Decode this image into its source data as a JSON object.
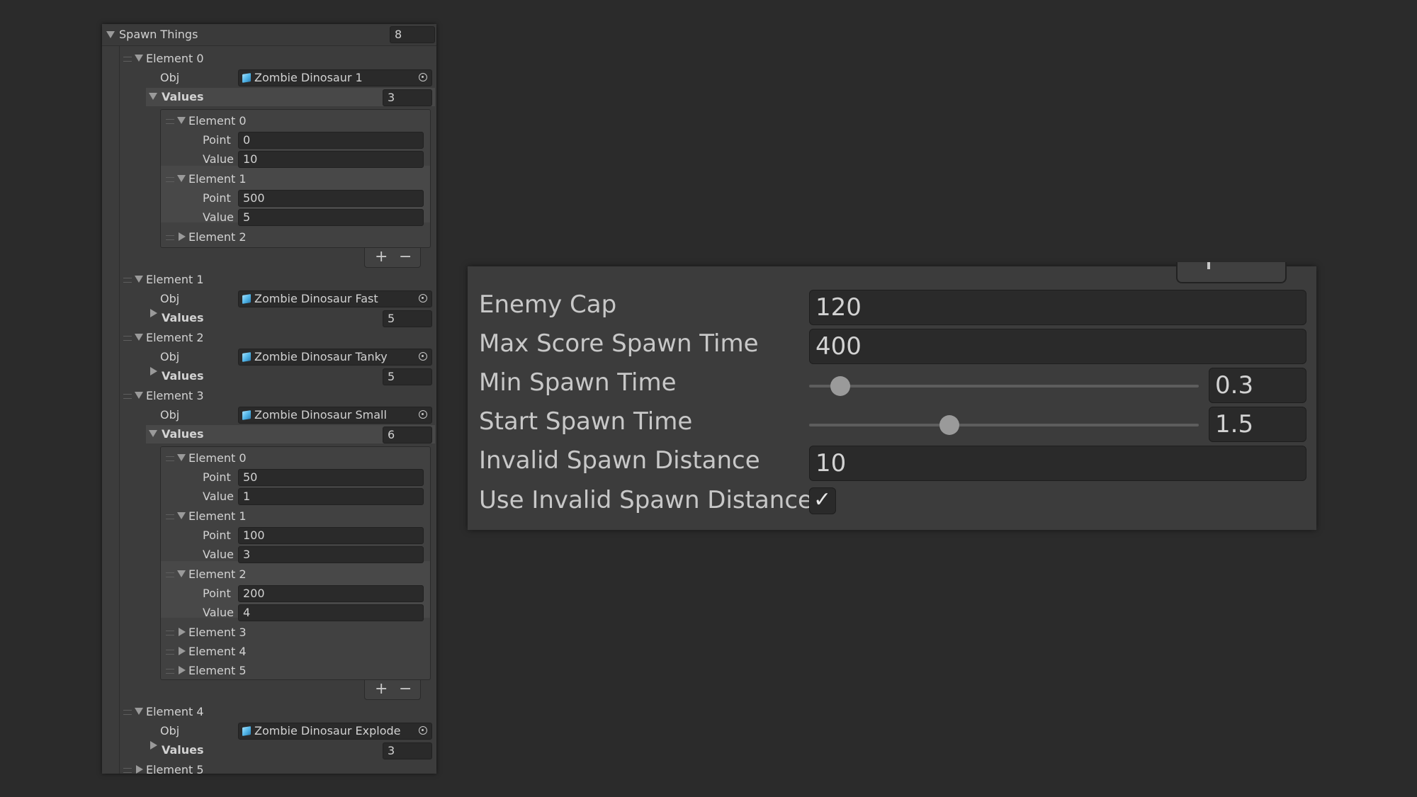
{
  "spawn_things": {
    "label": "Spawn Things",
    "size": "8",
    "elements": [
      {
        "label": "Element 0",
        "obj_label": "Obj",
        "obj": "Zombie Dinosaur 1",
        "values_label": "Values",
        "values_size": "3",
        "values": [
          {
            "label": "Element 0",
            "point_label": "Point",
            "point": "0",
            "value_label": "Value",
            "value": "10"
          },
          {
            "label": "Element 1",
            "point_label": "Point",
            "point": "500",
            "value_label": "Value",
            "value": "5"
          },
          {
            "label": "Element 2"
          }
        ]
      },
      {
        "label": "Element 1",
        "obj_label": "Obj",
        "obj": "Zombie Dinosaur Fast",
        "values_label": "Values",
        "values_size": "5"
      },
      {
        "label": "Element 2",
        "obj_label": "Obj",
        "obj": "Zombie Dinosaur Tanky",
        "values_label": "Values",
        "values_size": "5"
      },
      {
        "label": "Element 3",
        "obj_label": "Obj",
        "obj": "Zombie Dinosaur Small",
        "values_label": "Values",
        "values_size": "6",
        "values": [
          {
            "label": "Element 0",
            "point_label": "Point",
            "point": "50",
            "value_label": "Value",
            "value": "1"
          },
          {
            "label": "Element 1",
            "point_label": "Point",
            "point": "100",
            "value_label": "Value",
            "value": "3"
          },
          {
            "label": "Element 2",
            "point_label": "Point",
            "point": "200",
            "value_label": "Value",
            "value": "4"
          },
          {
            "label": "Element 3"
          },
          {
            "label": "Element 4"
          },
          {
            "label": "Element 5"
          }
        ]
      },
      {
        "label": "Element 4",
        "obj_label": "Obj",
        "obj": "Zombie Dinosaur Explode",
        "values_label": "Values",
        "values_size": "3"
      },
      {
        "label": "Element 5"
      }
    ],
    "plus_label": "+",
    "minus_label": "−"
  },
  "settings": {
    "enemy_cap": {
      "label": "Enemy Cap",
      "value": "120"
    },
    "max_score_spawn_time": {
      "label": "Max Score Spawn Time",
      "value": "400"
    },
    "min_spawn_time": {
      "label": "Min Spawn Time",
      "value": "0.3",
      "slider_fraction": 0.08
    },
    "start_spawn_time": {
      "label": "Start Spawn Time",
      "value": "1.5",
      "slider_fraction": 0.36
    },
    "invalid_spawn_distance": {
      "label": "Invalid Spawn Distance",
      "value": "10"
    },
    "use_invalid_spawn_distance": {
      "label": "Use Invalid Spawn Distance",
      "checked": true,
      "check_glyph": "✓"
    }
  }
}
